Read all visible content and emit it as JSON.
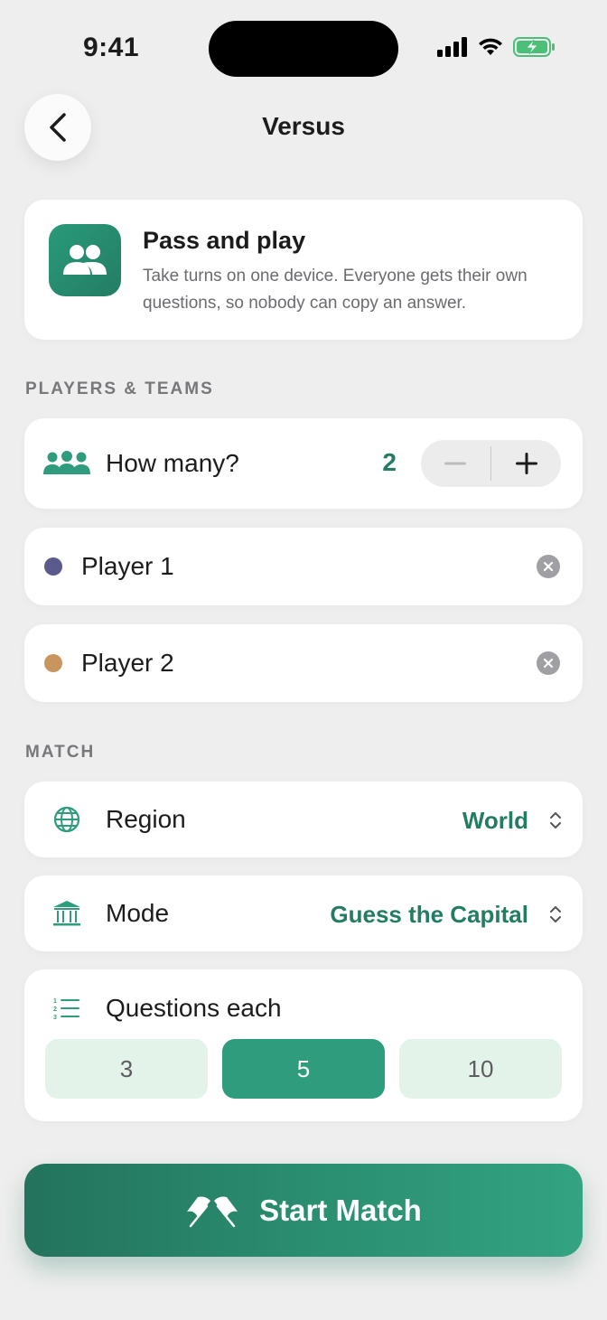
{
  "status": {
    "time": "9:41"
  },
  "nav": {
    "title": "Versus"
  },
  "intro": {
    "title": "Pass and play",
    "description": "Take turns on one device. Everyone gets their own questions, so nobody can copy an answer."
  },
  "players_section": {
    "label": "PLAYERS & TEAMS",
    "count_label": "How many?",
    "count_value": "2",
    "players": [
      {
        "name": "Player 1",
        "color": "#5b5a8c"
      },
      {
        "name": "Player 2",
        "color": "#c8955f"
      }
    ]
  },
  "match_section": {
    "label": "MATCH",
    "region": {
      "label": "Region",
      "value": "World"
    },
    "mode": {
      "label": "Mode",
      "value": "Guess the Capital"
    },
    "questions": {
      "label": "Questions each",
      "options": [
        "3",
        "5",
        "10"
      ],
      "selected": "5"
    }
  },
  "start_button": {
    "label": "Start Match"
  },
  "colors": {
    "accent": "#237c63",
    "accent_light": "#e3f3ea",
    "segment_active": "#2e9c7d"
  }
}
